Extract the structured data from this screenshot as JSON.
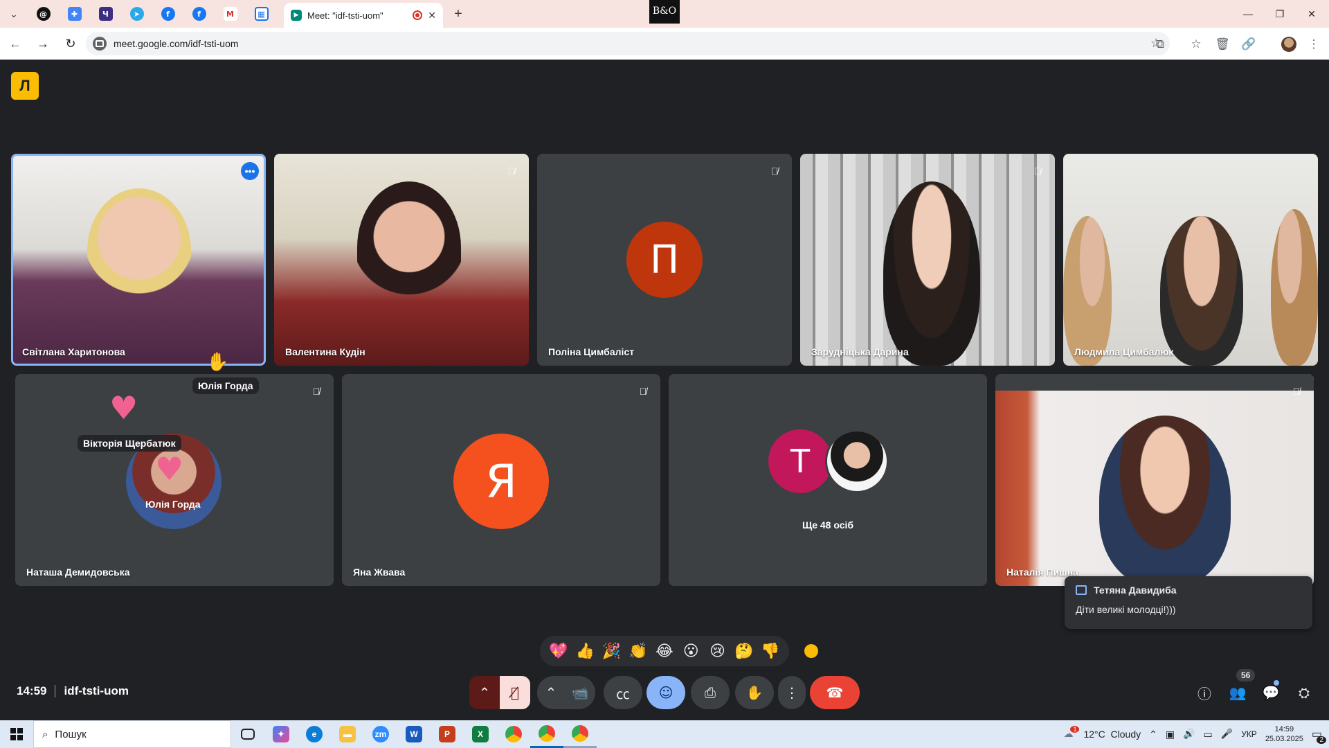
{
  "browser": {
    "active_tab_title": "Meet: \"idf-tsti-uom\"",
    "url": "meet.google.com/idf-tsti-uom",
    "center_logo": "B&O"
  },
  "meeting": {
    "code": "idf-tsti-uom",
    "time": "14:59",
    "participants_count": "56"
  },
  "tiles_row1": [
    {
      "name": "Світлана Харитонова"
    },
    {
      "name": "Валентина Кудін"
    },
    {
      "name": "Поліна Цимбаліст",
      "initial": "П"
    },
    {
      "name": "Зарудніцька Дарина"
    },
    {
      "name": "Людмила Цимбалюк"
    }
  ],
  "tiles_row2": [
    {
      "name": "Наташа Демидовська"
    },
    {
      "name": "Яна Жвава",
      "initial": "Я"
    },
    {
      "name": "Ще 48 осіб",
      "initial": "Т"
    },
    {
      "name": "Наталія Пишна"
    }
  ],
  "floating_labels": {
    "hand_raise_name": "Юлія Горда",
    "reaction_name_1": "Вікторія Щербатюк",
    "reaction_name_2": "Юлія Горда"
  },
  "chat_toast": {
    "sender": "Тетяна Давидиба",
    "message": "Діти великі молодці!)))"
  },
  "reactions": [
    "💖",
    "👍",
    "🎉",
    "👏",
    "😂",
    "😮",
    "😢",
    "🤔",
    "👎"
  ],
  "taskbar": {
    "search_placeholder": "Пошук",
    "weather": "12°C  Cloudy",
    "language": "УКР",
    "time": "14:59",
    "date": "25.03.2025",
    "notification_count": "2",
    "weather_alert": "1"
  },
  "colors": {
    "meet_bg": "#202124",
    "tile_bg": "#3c4043",
    "accent": "#8ab4f8",
    "end_call": "#ea4335",
    "mic_off": "#f9dedc",
    "emoji_active": "#8ab4f8",
    "avatar_p": "#bf360c",
    "avatar_ya": "#f4511e",
    "avatar_t": "#c2185b"
  }
}
